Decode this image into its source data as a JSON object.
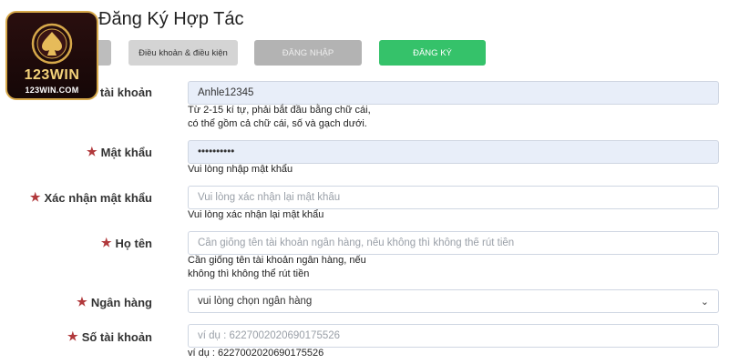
{
  "logo": {
    "brand": "123WIN",
    "url": "123WIN.COM"
  },
  "page": {
    "title": "Đăng Ký Hợp Tác"
  },
  "tabs": [
    {
      "label": ""
    },
    {
      "label": "Điều khoản & điều kiện"
    },
    {
      "label": "ĐĂNG NHẬP"
    },
    {
      "label": "ĐĂNG KÝ"
    }
  ],
  "form": {
    "username": {
      "label": "Tên tài khoản",
      "value": "Anhle12345",
      "hint_line1": "Từ 2-15 kí tự, phải bắt đầu bằng chữ cái,",
      "hint_line2": "có thể gồm cả chữ cái, số và gạch dưới."
    },
    "password": {
      "label": "Mật khẩu",
      "value": "••••••••••",
      "hint": "Vui lòng nhập mật khẩu"
    },
    "confirm_password": {
      "label": "Xác nhận mật khẩu",
      "placeholder": "Vui lòng xác nhận lại mật khẩu",
      "hint": "Vui lòng xác nhận lại mật khẩu"
    },
    "full_name": {
      "label": "Họ tên",
      "placeholder": "Cần giống tên tài khoản ngân hàng, nếu không thì không thể rút tiền",
      "hint_line1": "Cần giống tên tài khoản ngân hàng, nếu",
      "hint_line2": "không thì không thể rút tiền"
    },
    "bank": {
      "label": "Ngân hàng",
      "selected": "vui lòng chọn ngân hàng"
    },
    "account_number": {
      "label": "Số tài khoản",
      "placeholder": "ví dụ : 6227002020690175526",
      "hint": "ví dụ : 6227002020690175526"
    }
  },
  "colors": {
    "accent_green": "#35c26a",
    "star_red": "#b1393c",
    "filled_field": "#e8eef9"
  }
}
